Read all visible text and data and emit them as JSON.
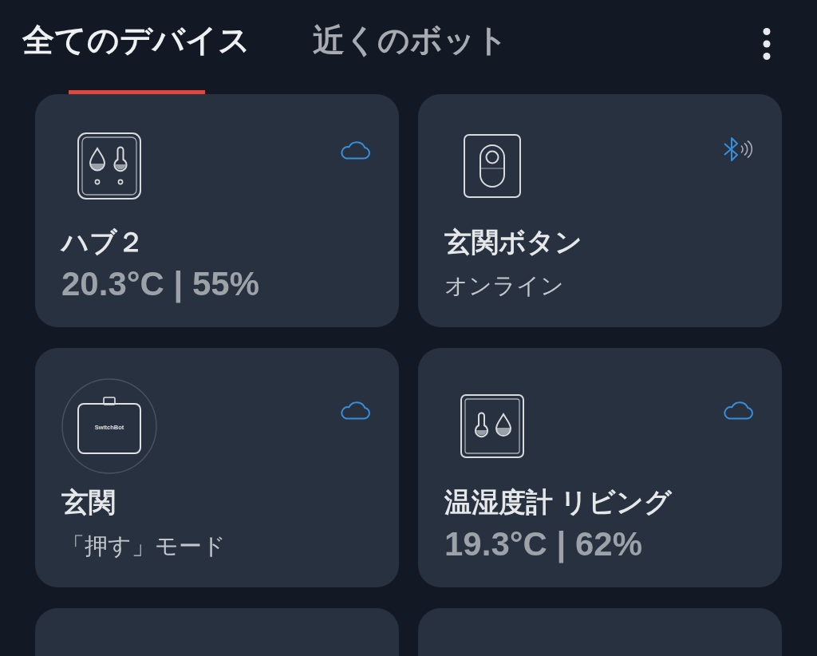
{
  "tabs": [
    {
      "label": "全てのデバイス",
      "selected": true
    },
    {
      "label": "近くのボット",
      "selected": false
    }
  ],
  "devices": [
    {
      "kind": "hub",
      "name": "ハブ２",
      "status": "20.3°C | 55%",
      "bluetooth": false
    },
    {
      "kind": "button",
      "name": "玄関ボタン",
      "status": "オンライン",
      "bluetooth": true
    },
    {
      "kind": "bot",
      "icon_label": "SwitchBot",
      "name": "玄関",
      "status": "「押す」モード",
      "bluetooth": false
    },
    {
      "kind": "meter",
      "name": "温湿度計 リビング",
      "status": "19.3°C | 62%",
      "bluetooth": false
    }
  ],
  "more_devices": [
    {
      "kind": "card"
    },
    {
      "kind": "card"
    }
  ]
}
